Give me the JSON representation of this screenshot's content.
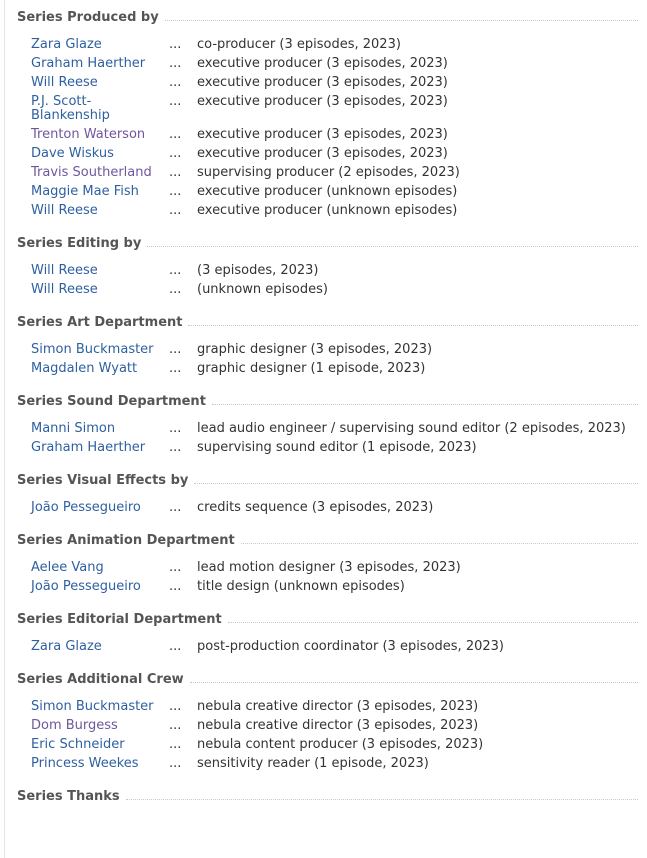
{
  "ellipsis": "...",
  "sections": [
    {
      "title": "Series Produced by",
      "rows": [
        {
          "name": "Zara Glaze",
          "role": "co-producer (3 episodes, 2023)",
          "visited": false
        },
        {
          "name": "Graham Haerther",
          "role": "executive producer (3 episodes, 2023)",
          "visited": false
        },
        {
          "name": "Will Reese",
          "role": "executive producer (3 episodes, 2023)",
          "visited": false
        },
        {
          "name": "P.J. Scott-Blankenship",
          "role": "executive producer (3 episodes, 2023)",
          "visited": false
        },
        {
          "name": "Trenton Waterson",
          "role": "executive producer (3 episodes, 2023)",
          "visited": true
        },
        {
          "name": "Dave Wiskus",
          "role": "executive producer (3 episodes, 2023)",
          "visited": false
        },
        {
          "name": "Travis Southerland",
          "role": "supervising producer (2 episodes, 2023)",
          "visited": true
        },
        {
          "name": "Maggie Mae Fish",
          "role": "executive producer (unknown episodes)",
          "visited": false
        },
        {
          "name": "Will Reese",
          "role": "executive producer (unknown episodes)",
          "visited": false
        }
      ]
    },
    {
      "title": "Series Editing by",
      "rows": [
        {
          "name": "Will Reese",
          "role": "(3 episodes, 2023)",
          "visited": false
        },
        {
          "name": "Will Reese",
          "role": "(unknown episodes)",
          "visited": false
        }
      ]
    },
    {
      "title": "Series Art Department",
      "rows": [
        {
          "name": "Simon Buckmaster",
          "role": "graphic designer (3 episodes, 2023)",
          "visited": false
        },
        {
          "name": "Magdalen Wyatt",
          "role": "graphic designer (1 episode, 2023)",
          "visited": false
        }
      ]
    },
    {
      "title": "Series Sound Department",
      "rows": [
        {
          "name": "Manni Simon",
          "role": "lead audio engineer / supervising sound editor (2 episodes, 2023)",
          "visited": false
        },
        {
          "name": "Graham Haerther",
          "role": "supervising sound editor (1 episode, 2023)",
          "visited": false
        }
      ]
    },
    {
      "title": "Series Visual Effects by",
      "rows": [
        {
          "name": "João Pessegueiro",
          "role": "credits sequence (3 episodes, 2023)",
          "visited": false
        }
      ]
    },
    {
      "title": "Series Animation Department",
      "rows": [
        {
          "name": "Aelee Vang",
          "role": "lead motion designer (3 episodes, 2023)",
          "visited": false
        },
        {
          "name": "João Pessegueiro",
          "role": "title design (unknown episodes)",
          "visited": false
        }
      ]
    },
    {
      "title": "Series Editorial Department",
      "rows": [
        {
          "name": "Zara Glaze",
          "role": "post-production coordinator (3 episodes, 2023)",
          "visited": false
        }
      ]
    },
    {
      "title": "Series Additional Crew",
      "rows": [
        {
          "name": "Simon Buckmaster",
          "role": "nebula creative director (3 episodes, 2023)",
          "visited": false
        },
        {
          "name": "Dom Burgess",
          "role": "nebula creative director (3 episodes, 2023)",
          "visited": true
        },
        {
          "name": "Eric Schneider",
          "role": "nebula content producer (3 episodes, 2023)",
          "visited": false
        },
        {
          "name": "Princess Weekes",
          "role": "sensitivity reader (1 episode, 2023)",
          "visited": false
        }
      ]
    },
    {
      "title": "Series Thanks",
      "rows": []
    }
  ]
}
